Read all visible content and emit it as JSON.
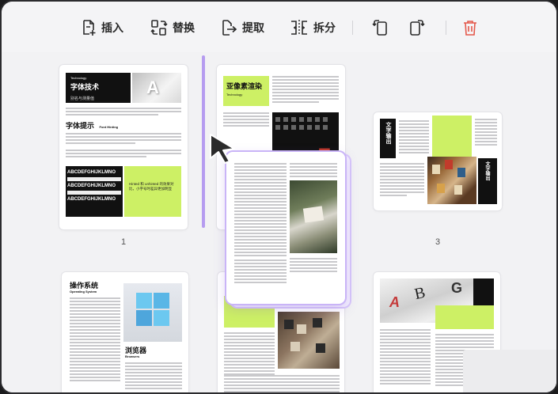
{
  "toolbar": {
    "insert_label": "插入",
    "replace_label": "替换",
    "extract_label": "提取",
    "split_label": "拆分"
  },
  "pages": [
    {
      "number": "1",
      "title": "字体技术",
      "subtitle": "Technology",
      "small": "别名与测量值",
      "section": "字体提示",
      "section_en": "Font Hinting",
      "glyphs": "ABCDEFGHIJKLMNO",
      "lime_text": "Hinted 和 unhinted 的效果对比，小字号时差异更加明显"
    },
    {
      "number": "",
      "title": "亚像素渲染",
      "subtitle": "Technology"
    },
    {
      "number": "3",
      "title": "文字输出"
    },
    {
      "number": "",
      "title": "操作系统",
      "subtitle": "Operating System",
      "section": "浏览器",
      "section_en": "Browsers"
    },
    {
      "number": "",
      "title": ""
    },
    {
      "number": "",
      "title": ""
    }
  ],
  "colors": {
    "accent": "#b69cf0",
    "lime": "#cdf065",
    "delete": "#e4574a"
  }
}
